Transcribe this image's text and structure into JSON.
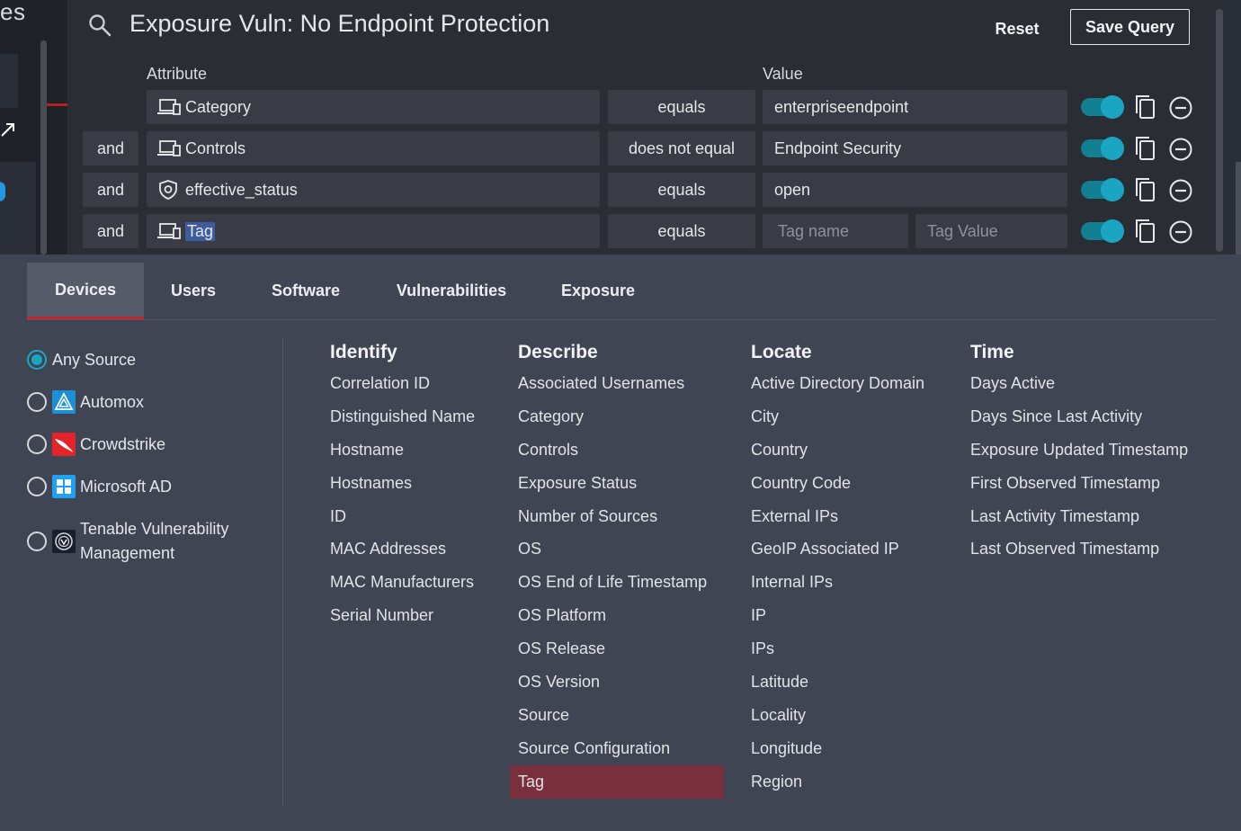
{
  "background": {
    "left_fragment": "es"
  },
  "query": {
    "title": "Exposure Vuln: No Endpoint Protection",
    "reset_label": "Reset",
    "save_label": "Save Query",
    "header_attribute": "Attribute",
    "header_value": "Value",
    "rows": [
      {
        "conjunction": "",
        "attribute": "Category",
        "attribute_icon": "device-icon",
        "operator": "equals",
        "value": "enterpriseendpoint",
        "enabled": true
      },
      {
        "conjunction": "and",
        "attribute": "Controls",
        "attribute_icon": "device-icon",
        "operator": "does not equal",
        "value": "Endpoint Security",
        "enabled": true
      },
      {
        "conjunction": "and",
        "attribute": "effective_status",
        "attribute_icon": "shield-icon",
        "operator": "equals",
        "value": "open",
        "enabled": true
      },
      {
        "conjunction": "and",
        "attribute": "Tag",
        "attribute_icon": "device-icon",
        "operator": "equals",
        "tag_name_placeholder": "Tag name",
        "tag_value_placeholder": "Tag Value",
        "enabled": true
      }
    ],
    "toggle_color": "#1aa6c2"
  },
  "tabs": [
    {
      "label": "Devices",
      "active": true
    },
    {
      "label": "Users",
      "active": false
    },
    {
      "label": "Software",
      "active": false
    },
    {
      "label": "Vulnerabilities",
      "active": false
    },
    {
      "label": "Exposure",
      "active": false
    }
  ],
  "sources": [
    {
      "label": "Any Source",
      "checked": true,
      "icon": ""
    },
    {
      "label": "Automox",
      "checked": false,
      "icon": "automox-icon"
    },
    {
      "label": "Crowdstrike",
      "checked": false,
      "icon": "crowdstrike-icon"
    },
    {
      "label": "Microsoft AD",
      "checked": false,
      "icon": "windows-icon"
    },
    {
      "label": "Tenable Vulnerability",
      "label2": "Management",
      "checked": false,
      "icon": "tenable-icon"
    }
  ],
  "columns": {
    "identify": {
      "title": "Identify",
      "items": [
        "Correlation ID",
        "Distinguished Name",
        "Hostname",
        "Hostnames",
        "ID",
        "MAC Addresses",
        "MAC Manufacturers",
        "Serial Number"
      ]
    },
    "describe": {
      "title": "Describe",
      "items": [
        "Associated Usernames",
        "Category",
        "Controls",
        "Exposure Status",
        "Number of Sources",
        "OS",
        "OS End of Life Timestamp",
        "OS Platform",
        "OS Release",
        "OS Version",
        "Source",
        "Source Configuration",
        "Tag"
      ],
      "selected": "Tag"
    },
    "locate": {
      "title": "Locate",
      "items": [
        "Active Directory Domain",
        "City",
        "Country",
        "Country Code",
        "External IPs",
        "GeoIP Associated IP",
        "Internal IPs",
        "IP",
        "IPs",
        "Latitude",
        "Locality",
        "Longitude",
        "Region"
      ]
    },
    "time": {
      "title": "Time",
      "items": [
        "Days Active",
        "Days Since Last Activity",
        "Exposure Updated Timestamp",
        "First Observed Timestamp",
        "Last Activity Timestamp",
        "Last Observed Timestamp"
      ]
    }
  },
  "colors": {
    "accent": "#1aa6c2",
    "selected_item": "#7a2f3c",
    "active_tab_underline": "#c2282f"
  }
}
